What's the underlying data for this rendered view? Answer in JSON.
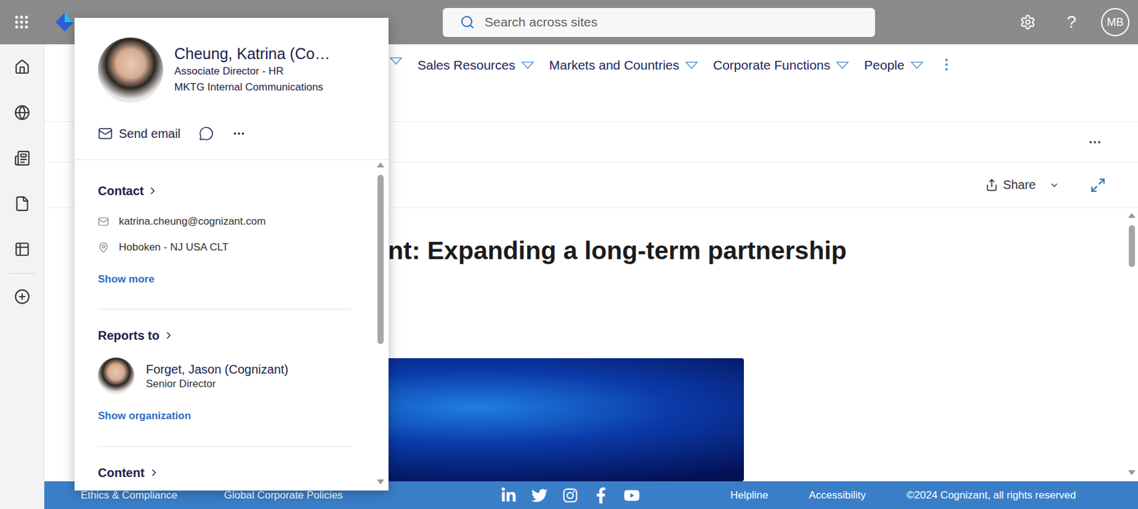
{
  "topbar": {
    "search_placeholder": "Search across sites",
    "help": "?",
    "avatar_initials": "MB"
  },
  "nav": [
    {
      "label": "Sales Resources"
    },
    {
      "label": "Markets and Countries"
    },
    {
      "label": "Corporate Functions"
    },
    {
      "label": "People"
    }
  ],
  "share": {
    "label": "Share"
  },
  "article": {
    "title": "nt: Expanding a long-term partnership"
  },
  "footer": {
    "links": [
      "Ethics & Compliance",
      "Global Corporate Policies"
    ],
    "right_links": [
      "Helpline",
      "Accessibility"
    ],
    "copyright": "©2024 Cognizant, all rights reserved"
  },
  "profile_card": {
    "name": "Cheung, Katrina (Co…",
    "title": "Associate Director - HR",
    "department": "MKTG Internal Communications",
    "send_email": "Send email",
    "contact": {
      "heading": "Contact",
      "email": "katrina.cheung@cognizant.com",
      "location": "Hoboken - NJ USA CLT",
      "show_more": "Show more"
    },
    "reports_to": {
      "heading": "Reports to",
      "name": "Forget, Jason (Cognizant)",
      "title": "Senior Director",
      "show_org": "Show organization"
    },
    "content": {
      "heading": "Content"
    }
  }
}
